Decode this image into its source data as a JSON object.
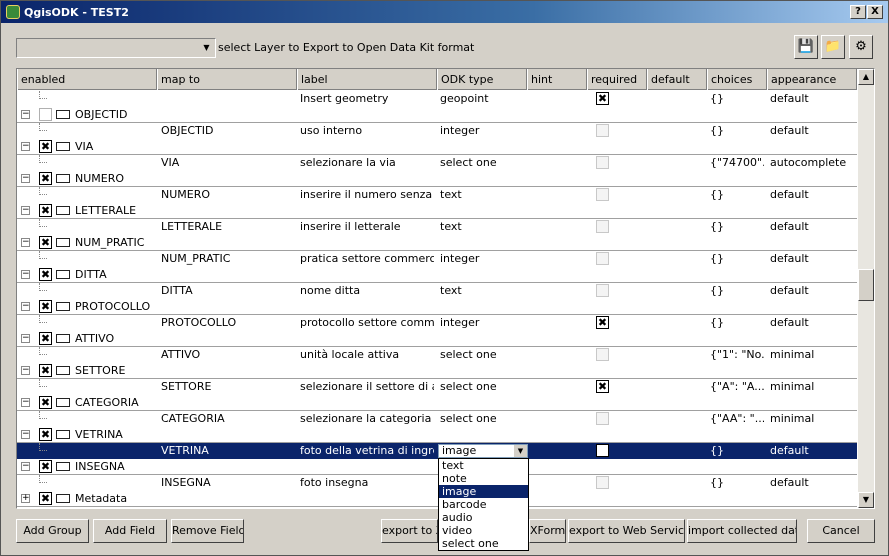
{
  "window": {
    "title": "QgisODK - TEST2",
    "help_label": "?",
    "close_label": "X"
  },
  "toolbar": {
    "layer_label": "select Layer to Export to Open Data Kit format",
    "layer_value": ""
  },
  "columns": [
    "enabled",
    "map to",
    "label",
    "ODK type",
    "hint",
    "required",
    "default",
    "choices",
    "appearance"
  ],
  "geometry_row": {
    "label": "Insert geometry",
    "type": "geopoint",
    "required": true,
    "choices": "{}",
    "appearance": "default"
  },
  "fields": [
    {
      "name": "OBJECTID",
      "enabled": false,
      "map_to": "OBJECTID",
      "label": "uso interno",
      "type": "integer",
      "required": false,
      "choices": "{}",
      "appearance": "default"
    },
    {
      "name": "VIA",
      "enabled": true,
      "map_to": "VIA",
      "label": "selezionare la via",
      "type": "select one",
      "required": false,
      "choices": "{\"74700\"...",
      "appearance": "autocomplete"
    },
    {
      "name": "NUMERO",
      "enabled": true,
      "map_to": "NUMERO",
      "label": "inserire il numero senza le...",
      "type": "text",
      "required": false,
      "choices": "{}",
      "appearance": "default"
    },
    {
      "name": "LETTERALE",
      "enabled": true,
      "map_to": "LETTERALE",
      "label": "inserire il letterale",
      "type": "text",
      "required": false,
      "choices": "{}",
      "appearance": "default"
    },
    {
      "name": "NUM_PRATIC",
      "enabled": true,
      "map_to": "NUM_PRATIC",
      "label": "pratica settore commercio",
      "type": "integer",
      "required": false,
      "choices": "{}",
      "appearance": "default"
    },
    {
      "name": "DITTA",
      "enabled": true,
      "map_to": "DITTA",
      "label": "nome ditta",
      "type": "text",
      "required": false,
      "choices": "{}",
      "appearance": "default"
    },
    {
      "name": "PROTOCOLLO",
      "enabled": true,
      "map_to": "PROTOCOLLO",
      "label": "protocollo settore comme...",
      "type": "integer",
      "required": true,
      "choices": "{}",
      "appearance": "default"
    },
    {
      "name": "ATTIVO",
      "enabled": true,
      "map_to": "ATTIVO",
      "label": "unità locale attiva",
      "type": "select one",
      "required": false,
      "choices": "{\"1\": \"No...",
      "appearance": "minimal"
    },
    {
      "name": "SETTORE",
      "enabled": true,
      "map_to": "SETTORE",
      "label": "selezionare il settore di at...",
      "type": "select one",
      "required": true,
      "choices": "{\"A\": \"A...",
      "appearance": "minimal"
    },
    {
      "name": "CATEGORIA",
      "enabled": true,
      "map_to": "CATEGORIA",
      "label": "selezionare la categoria m...",
      "type": "select one",
      "required": false,
      "choices": "{\"AA\": \"...",
      "appearance": "minimal"
    },
    {
      "name": "VETRINA",
      "enabled": true,
      "map_to": "VETRINA",
      "label": "foto della vetrina di ingre...",
      "type": "image",
      "required": true,
      "choices": "{}",
      "appearance": "default",
      "selected": true
    },
    {
      "name": "INSEGNA",
      "enabled": true,
      "map_to": "INSEGNA",
      "label": "foto insegna",
      "type": "",
      "required": false,
      "choices": "{}",
      "appearance": "default"
    }
  ],
  "last_group": {
    "name": "Metadata",
    "enabled": true
  },
  "type_dropdown": {
    "options": [
      "text",
      "note",
      "image",
      "barcode",
      "audio",
      "video",
      "select one"
    ],
    "highlighted": "image"
  },
  "buttons": {
    "add_group": "Add Group",
    "add_field": "Add Field",
    "remove_field": "Remove Field",
    "export_to_x": "export to X",
    "xform": "XForm",
    "export_web": "export to Web Service",
    "import_collected": "import collected data",
    "cancel": "Cancel"
  }
}
